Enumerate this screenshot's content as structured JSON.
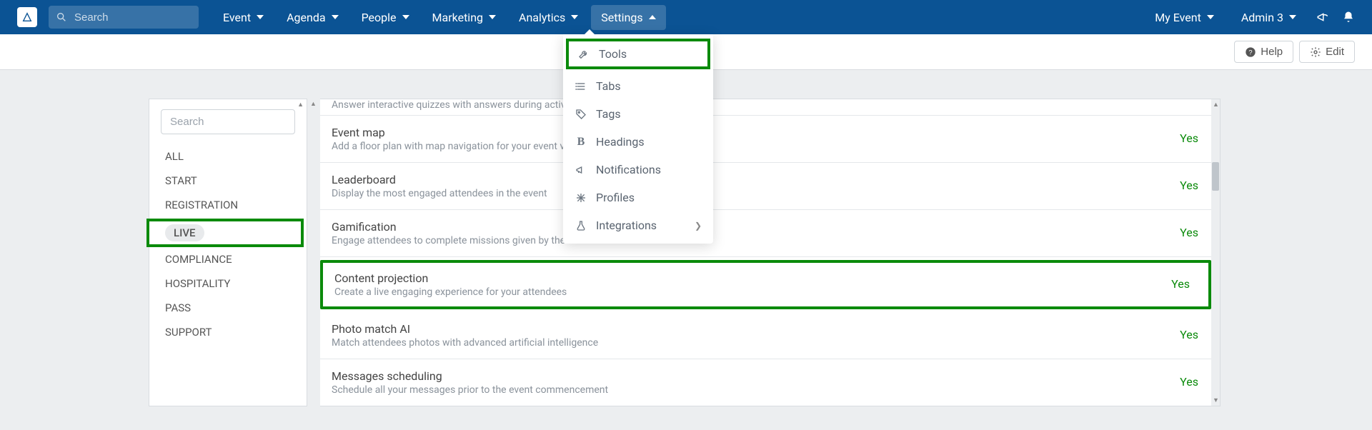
{
  "navbar": {
    "search_placeholder": "Search",
    "items": [
      {
        "label": "Event"
      },
      {
        "label": "Agenda"
      },
      {
        "label": "People"
      },
      {
        "label": "Marketing"
      },
      {
        "label": "Analytics"
      },
      {
        "label": "Settings"
      }
    ],
    "right": {
      "event_label": "My Event",
      "user_label": "Admin 3"
    }
  },
  "subheader": {
    "help_label": "Help",
    "edit_label": "Edit"
  },
  "dropdown": {
    "items": [
      {
        "label": "Tools"
      },
      {
        "label": "Tabs"
      },
      {
        "label": "Tags"
      },
      {
        "label": "Headings"
      },
      {
        "label": "Notifications"
      },
      {
        "label": "Profiles"
      },
      {
        "label": "Integrations"
      }
    ]
  },
  "sidebar": {
    "search_placeholder": "Search",
    "categories": [
      {
        "label": "ALL"
      },
      {
        "label": "START"
      },
      {
        "label": "REGISTRATION"
      },
      {
        "label": "LIVE"
      },
      {
        "label": "COMPLIANCE"
      },
      {
        "label": "HOSPITALITY"
      },
      {
        "label": "PASS"
      },
      {
        "label": "SUPPORT"
      }
    ]
  },
  "tools": {
    "cutoff": "Answer interactive quizzes with answers during activiti",
    "rows": [
      {
        "title": "Event map",
        "desc": "Add a floor plan with map navigation for your event ve",
        "status": "Yes"
      },
      {
        "title": "Leaderboard",
        "desc": "Display the most engaged attendees in the event",
        "status": "Yes"
      },
      {
        "title": "Gamification",
        "desc": "Engage attendees to complete missions given by the ev",
        "status": "Yes"
      },
      {
        "title": "Content projection",
        "desc": "Create a live engaging experience for your attendees",
        "status": "Yes"
      },
      {
        "title": "Photo match AI",
        "desc": "Match attendees photos with advanced artificial intelligence",
        "status": "Yes"
      },
      {
        "title": "Messages scheduling",
        "desc": "Schedule all your messages prior to the event commencement",
        "status": "Yes"
      }
    ]
  }
}
